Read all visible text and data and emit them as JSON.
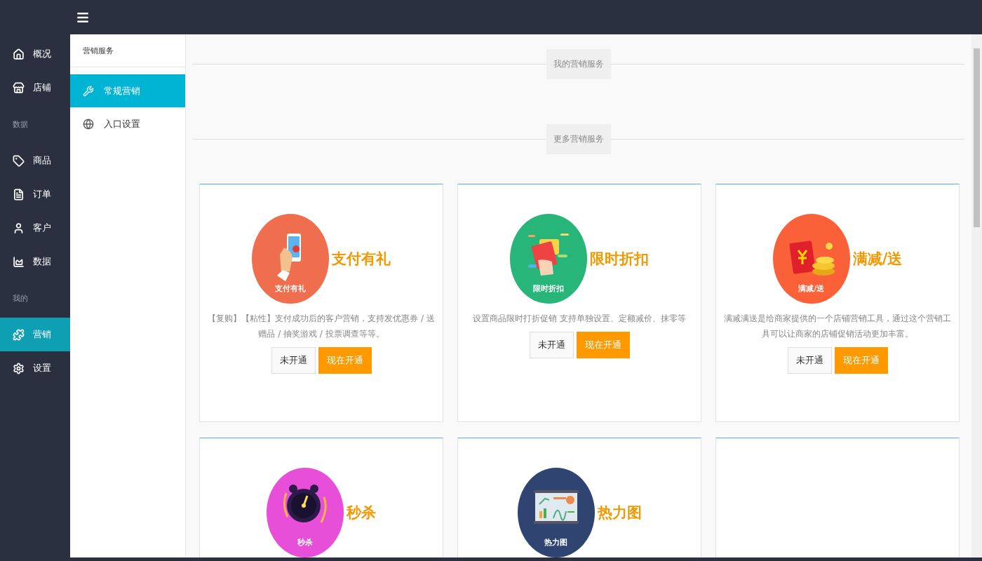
{
  "nav": [
    {
      "kind": "item",
      "label": "概况",
      "selected": false
    },
    {
      "kind": "item",
      "label": "店铺",
      "selected": false
    },
    {
      "kind": "section",
      "label": "数据"
    },
    {
      "kind": "item",
      "label": "商品",
      "selected": false
    },
    {
      "kind": "item",
      "label": "订单",
      "selected": false
    },
    {
      "kind": "item",
      "label": "客户",
      "selected": false
    },
    {
      "kind": "item",
      "label": "数据",
      "selected": false
    },
    {
      "kind": "section",
      "label": "我的"
    },
    {
      "kind": "item",
      "label": "营销",
      "selected": true
    },
    {
      "kind": "item",
      "label": "设置",
      "selected": false
    }
  ],
  "subnav": {
    "title": "营销服务",
    "items": [
      {
        "label": "常规营销",
        "selected": true
      },
      {
        "label": "入口设置",
        "selected": false
      }
    ]
  },
  "sections": [
    {
      "title": "我的营销服务"
    },
    {
      "title": "更多营销服务"
    }
  ],
  "cards": [
    {
      "kind": "phone",
      "color": "#ee6e4e",
      "caption": "支付有礼",
      "title": "支付有礼",
      "description": "【复购】【粘性】支付成功后的客户营销，支持发优惠券 / 送赠品 / 抽奖游戏 / 投票调查等等。",
      "buttons": [
        "未开通",
        "现在开通"
      ]
    },
    {
      "kind": "packet",
      "color": "#27b57a",
      "caption": "限时折扣",
      "title": "限时折扣",
      "description": "设置商品限时打折促销 支持单独设置、定额减价、抹零等",
      "buttons": [
        "未开通",
        "现在开通"
      ]
    },
    {
      "kind": "coins",
      "color": "#fa6138",
      "caption": "满减/送",
      "title": "满减/送",
      "description": "满减满送是给商家提供的一个店铺营销工具，通过这个营销工具可以让商家的店铺促销活动更加丰富。",
      "buttons": [
        "未开通",
        "现在开通"
      ]
    },
    {
      "kind": "clock",
      "color": "#e84fd8",
      "caption": "秒杀",
      "title": "秒杀"
    },
    {
      "kind": "board",
      "color": "#2f4470",
      "caption": "热力图",
      "title": "热力图"
    }
  ]
}
